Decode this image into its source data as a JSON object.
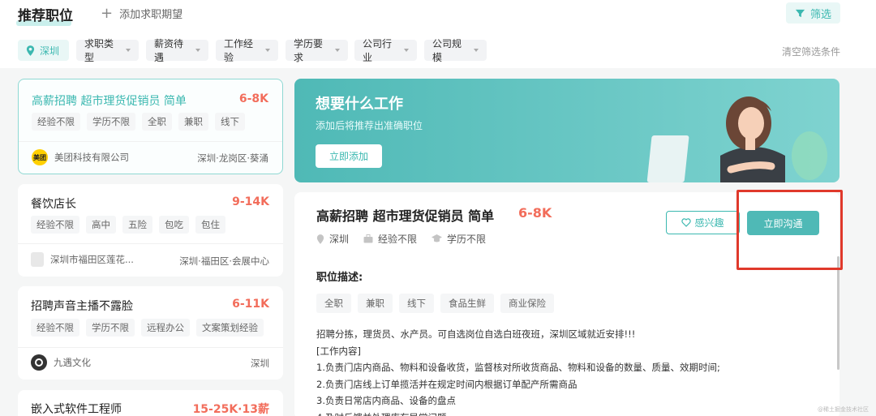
{
  "header": {
    "title": "推荐职位",
    "add_expectation": "添加求职期望",
    "filter_button": "筛选"
  },
  "filters": {
    "city": "深圳",
    "items": [
      "求职类型",
      "薪资待遇",
      "工作经验",
      "学历要求",
      "公司行业",
      "公司规模"
    ],
    "clear": "清空筛选条件"
  },
  "jobs": [
    {
      "title": "高薪招聘 超市理货促销员 简单",
      "salary": "6-8K",
      "tags": [
        "经验不限",
        "学历不限",
        "全职",
        "兼职",
        "线下"
      ],
      "company": "美团科技有限公司",
      "logo_text": "美团",
      "location": "深圳·龙岗区·葵涌"
    },
    {
      "title": "餐饮店长",
      "salary": "9-14K",
      "tags": [
        "经验不限",
        "高中",
        "五险",
        "包吃",
        "包住"
      ],
      "company": "深圳市福田区莲花...",
      "location": "深圳·福田区·会展中心"
    },
    {
      "title": "招聘声音主播不露脸",
      "salary": "6-11K",
      "tags": [
        "经验不限",
        "学历不限",
        "远程办公",
        "文案策划经验"
      ],
      "company": "九遇文化",
      "location": "深圳"
    },
    {
      "title": "嵌入式软件工程师",
      "salary": "15-25K·13薪"
    }
  ],
  "banner": {
    "title": "想要什么工作",
    "subtitle": "添加后将推荐出准确职位",
    "button": "立即添加"
  },
  "detail": {
    "title": "高薪招聘 超市理货促销员 简单",
    "salary": "6-8K",
    "city": "深圳",
    "experience": "经验不限",
    "education": "学历不限",
    "fav_button": "感兴趣",
    "chat_button": "立即沟通",
    "section_title": "职位描述:",
    "tags": [
      "全职",
      "兼职",
      "线下",
      "食品生鲜",
      "商业保险"
    ],
    "description": [
      "招聘分拣，理货员、水产员。可自选岗位自选白班夜班，深圳区域就近安排!!!",
      "[工作内容]",
      "1.负责门店内商品、物料和设备收货，监督核对所收货商品、物料和设备的数量、质量、效期时间;",
      "2.负责门店线上订单揽活并在规定时间内根据订单配产所需商品",
      "3.负责日常店内商品、设备的盘点",
      "4.及时反馈并处理库存异常问题;"
    ]
  },
  "watermark": "@稀土掘金技术社区",
  "colors": {
    "accent": "#3bb8b0",
    "salary": "#f26d5b",
    "highlight": "#e0392b"
  }
}
